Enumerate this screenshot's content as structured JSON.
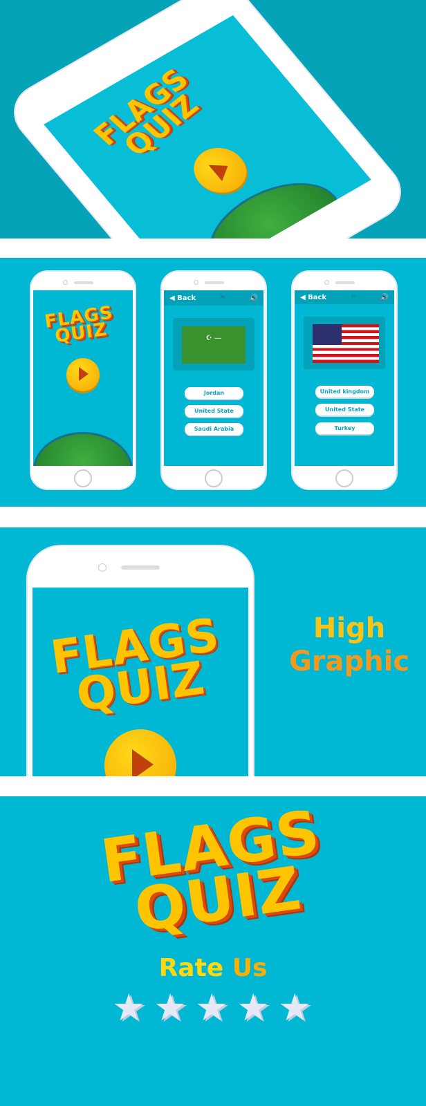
{
  "app": {
    "logo_text_line1": "FLAGS",
    "logo_text_line2": "QUIZ"
  },
  "colors": {
    "teal_dark": "#04a3b8",
    "teal": "#00b8d4",
    "logo_yellow": "#ffc400",
    "logo_orange": "#d9480f",
    "button_text": "#0aa3c2"
  },
  "quiz_screen_1": {
    "back_label": "Back",
    "flag": "Saudi Arabia",
    "options": [
      "Jordan",
      "United State",
      "Saudi Arabia"
    ]
  },
  "quiz_screen_2": {
    "back_label": "Back",
    "flag": "United States",
    "options": [
      "United kingdom",
      "United State",
      "Turkey"
    ]
  },
  "feature": {
    "line1": "High",
    "line2": "Graphic"
  },
  "rate": {
    "word1": "Rate",
    "word2": "Us",
    "stars": 5
  },
  "icons": {
    "back": "chevron-left-icon",
    "flag": "flag-icon",
    "sound": "speaker-icon",
    "play": "play-icon",
    "star": "star-icon"
  }
}
